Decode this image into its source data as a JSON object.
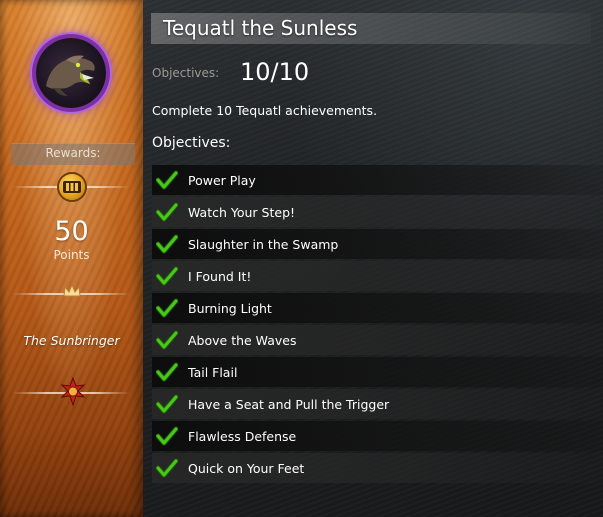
{
  "achievement": {
    "title": "Tequatl the Sunless",
    "objectives_label": "Objectives:",
    "progress": "10/10",
    "description": "Complete 10 Tequatl achievements.",
    "objectives_heading": "Objectives:",
    "objectives": [
      {
        "label": "Power Play",
        "completed": true
      },
      {
        "label": "Watch Your Step!",
        "completed": true
      },
      {
        "label": "Slaughter in the Swamp",
        "completed": true
      },
      {
        "label": "I Found It!",
        "completed": true
      },
      {
        "label": "Burning Light",
        "completed": true
      },
      {
        "label": "Above the Waves",
        "completed": true
      },
      {
        "label": "Tail Flail",
        "completed": true
      },
      {
        "label": "Have a Seat and Pull the Trigger",
        "completed": true
      },
      {
        "label": "Flawless Defense",
        "completed": true
      },
      {
        "label": "Quick on Your Feet",
        "completed": true
      }
    ]
  },
  "rewards": {
    "label": "Rewards:",
    "points_value": "50",
    "points_label": "Points",
    "title_reward": "The Sunbringer"
  },
  "icons": {
    "emblem": "tequatl-dragon-icon",
    "points": "achievement-points-icon",
    "title": "crown-icon",
    "mastery": "sun-emblem-icon",
    "objective": "green-check-icon"
  },
  "colors": {
    "side_panel": "#c8691d",
    "check": "#3fbf17",
    "emblem_ring": "#7c2fa6"
  }
}
